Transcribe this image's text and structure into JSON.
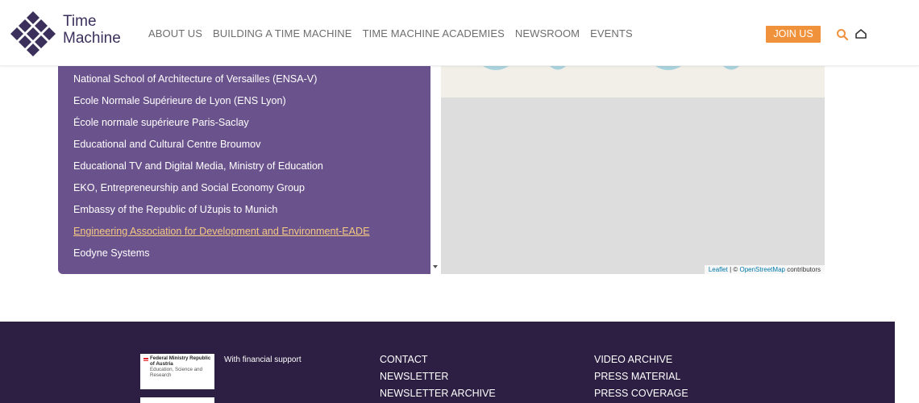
{
  "header": {
    "logo_line1": "Time",
    "logo_line2": "Machine",
    "nav": [
      "ABOUT US",
      "BUILDING A TIME MACHINE",
      "TIME MACHINE ACADEMIES",
      "NEWSROOM",
      "EVENTS"
    ],
    "join_label": "JOIN US",
    "colors": {
      "brand": "#3b2f5c",
      "accent": "#f0923b"
    },
    "icons": [
      "search-icon",
      "user-icon"
    ]
  },
  "list": {
    "items": [
      "National School of Architecture of Versailles (ENSA-V)",
      "Ecole Normale Supérieure de Lyon (ENS Lyon)",
      "École normale supérieure Paris-Saclay",
      "Educational and Cultural Centre Broumov",
      "Educational TV and Digital Media, Ministry of Education",
      "EKO, Entrepreneurship and Social Economy Group",
      "Embassy of the Republic of Užupis to Munich",
      "Engineering Association for Development and Environment-EADE",
      "Eodyne Systems"
    ],
    "active_index": 7,
    "panel_color": "#6a528c"
  },
  "map": {
    "attribution_leaflet": "Leaflet",
    "attribution_sep": " | © ",
    "attribution_osm": "OpenStreetMap",
    "attribution_tail": " contributors"
  },
  "footer": {
    "sponsor_name": "Federal Ministry Republic of Austria",
    "sponsor_sub": "Education, Science and Research",
    "support_text": "With financial support",
    "col1": [
      "CONTACT",
      "NEWSLETTER",
      "NEWSLETTER ARCHIVE"
    ],
    "col2": [
      "VIDEO ARCHIVE",
      "PRESS MATERIAL",
      "PRESS COVERAGE"
    ],
    "background": "#2c1f43"
  }
}
